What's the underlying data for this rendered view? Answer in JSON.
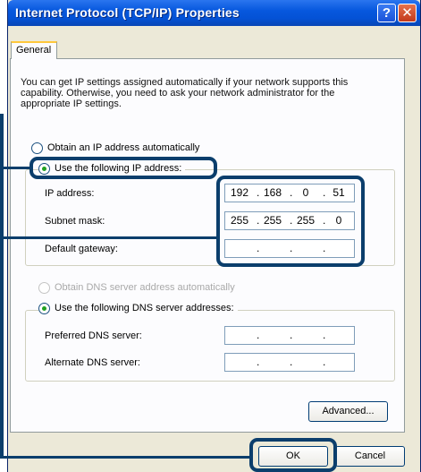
{
  "window": {
    "title": "Internet Protocol (TCP/IP) Properties",
    "help_glyph": "?",
    "close_glyph": "✕"
  },
  "tabs": [
    {
      "label": "General",
      "active": true
    }
  ],
  "description": "You can get IP settings assigned automatically if your network supports this capability. Otherwise, you need to ask your network administrator for the appropriate IP settings.",
  "ip_mode": {
    "auto_label": "Obtain an IP address automatically",
    "manual_label": "Use the following IP address:",
    "selected": "manual"
  },
  "ip_fields": [
    {
      "label": "IP address:",
      "octets": [
        "192",
        "168",
        "0",
        "51"
      ]
    },
    {
      "label": "Subnet mask:",
      "octets": [
        "255",
        "255",
        "255",
        "0"
      ]
    },
    {
      "label": "Default gateway:",
      "octets": [
        "",
        "",
        "",
        ""
      ]
    }
  ],
  "dns_mode": {
    "auto_label": "Obtain DNS server address automatically",
    "auto_disabled": true,
    "manual_label": "Use the following DNS server addresses:",
    "selected": "manual"
  },
  "dns_fields": [
    {
      "label": "Preferred DNS server:",
      "octets": [
        "",
        "",
        "",
        ""
      ]
    },
    {
      "label": "Alternate DNS server:",
      "octets": [
        "",
        "",
        "",
        ""
      ]
    }
  ],
  "buttons": {
    "advanced": "Advanced...",
    "ok": "OK",
    "cancel": "Cancel"
  },
  "colors": {
    "titlebar": "#0758de",
    "callout": "#0b3e6c",
    "radio_dot": "#21a121"
  }
}
